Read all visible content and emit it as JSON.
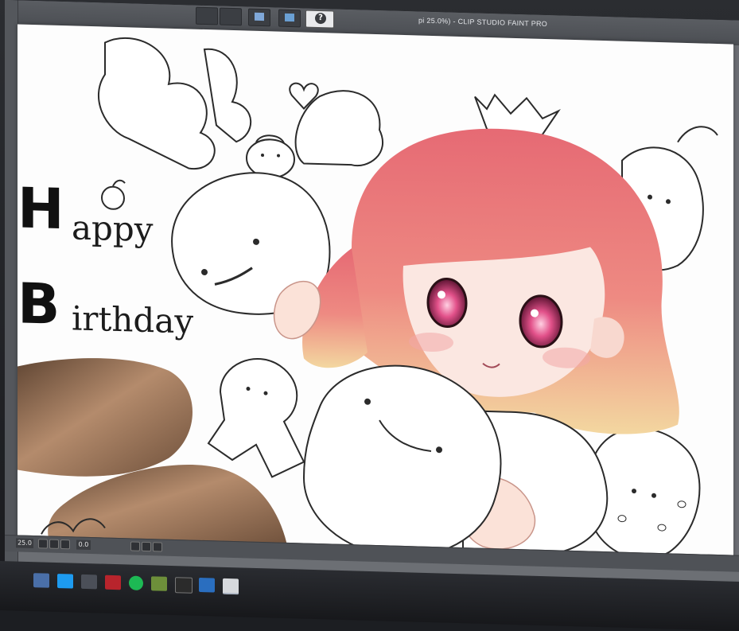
{
  "window": {
    "title": "pi 25.0%) - CLIP STUDIO FAINT PRO"
  },
  "toolbar": {
    "help_icon": "question-icon"
  },
  "canvas": {
    "greeting_line1": "Happy",
    "greeting_line2": "Birthday",
    "monogram": "HB"
  },
  "status": {
    "zoom": "25.0",
    "angle": "0.0"
  },
  "colors": {
    "hair": "#e6707a",
    "hair_tips": "#f3d7a0",
    "skin": "#fbe7e1",
    "leg": "#8a6648",
    "eye": "#d9457a",
    "lineart": "#2b2b2b",
    "ui_panel": "#55585d"
  },
  "taskbar": {
    "icons": [
      "mail-icon",
      "twitter-icon",
      "store-icon",
      "game-icon",
      "spotify-icon",
      "minecraft-icon",
      "cmd-icon",
      "arrow-icon",
      "clip-studio-icon"
    ]
  }
}
